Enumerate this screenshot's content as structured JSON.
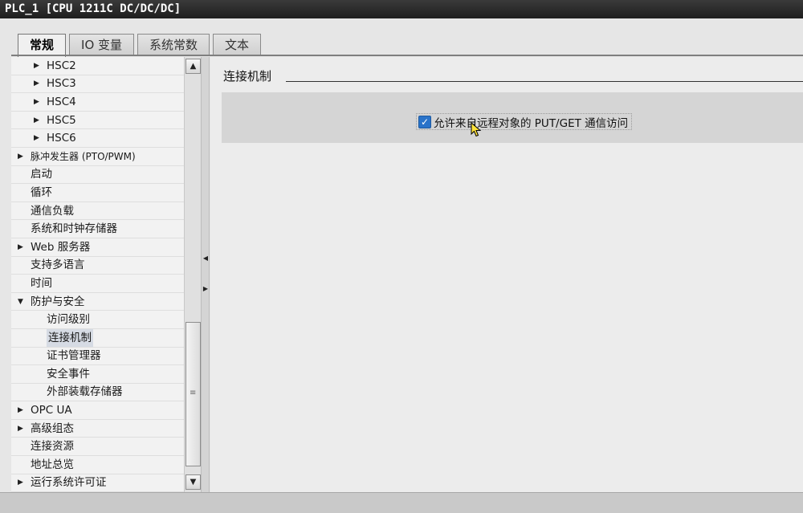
{
  "window": {
    "title": "PLC_1 [CPU 1211C DC/DC/DC]"
  },
  "tabs": [
    {
      "label": "常规",
      "active": true
    },
    {
      "label": "IO 变量",
      "active": false
    },
    {
      "label": "系统常数",
      "active": false
    },
    {
      "label": "文本",
      "active": false
    }
  ],
  "tree": {
    "items": [
      {
        "label": "HSC2",
        "arrow": "right",
        "level": 1
      },
      {
        "label": "HSC3",
        "arrow": "right",
        "level": 1
      },
      {
        "label": "HSC4",
        "arrow": "right",
        "level": 1
      },
      {
        "label": "HSC5",
        "arrow": "right",
        "level": 1
      },
      {
        "label": "HSC6",
        "arrow": "right",
        "level": 1
      },
      {
        "label": "脉冲发生器 (PTO/PWM)",
        "arrow": "right",
        "level": 0
      },
      {
        "label": "启动",
        "arrow": "none",
        "level": 0
      },
      {
        "label": "循环",
        "arrow": "none",
        "level": 0
      },
      {
        "label": "通信负载",
        "arrow": "none",
        "level": 0
      },
      {
        "label": "系统和时钟存储器",
        "arrow": "none",
        "level": 0
      },
      {
        "label": "Web 服务器",
        "arrow": "right",
        "level": 0
      },
      {
        "label": "支持多语言",
        "arrow": "none",
        "level": 0
      },
      {
        "label": "时间",
        "arrow": "none",
        "level": 0
      },
      {
        "label": "防护与安全",
        "arrow": "down",
        "level": 0
      },
      {
        "label": "访问级别",
        "arrow": "none",
        "level": 1
      },
      {
        "label": "连接机制",
        "arrow": "none",
        "level": 1,
        "selected": true
      },
      {
        "label": "证书管理器",
        "arrow": "none",
        "level": 1
      },
      {
        "label": "安全事件",
        "arrow": "none",
        "level": 1
      },
      {
        "label": "外部装载存储器",
        "arrow": "none",
        "level": 1
      },
      {
        "label": "OPC UA",
        "arrow": "right",
        "level": 0
      },
      {
        "label": "高级组态",
        "arrow": "right",
        "level": 0
      },
      {
        "label": "连接资源",
        "arrow": "none",
        "level": 0
      },
      {
        "label": "地址总览",
        "arrow": "none",
        "level": 0
      },
      {
        "label": "运行系统许可证",
        "arrow": "right",
        "level": 0
      }
    ]
  },
  "content": {
    "section_title": "连接机制",
    "checkbox": {
      "label": "允许来自远程对象的 PUT/GET 通信访问",
      "checked": true
    }
  },
  "icons": {
    "arrow_right": "▶",
    "arrow_down": "▼",
    "scroll_up": "▲",
    "scroll_down": "▼",
    "check": "✓",
    "grip": "≡"
  },
  "colors": {
    "checkbox_accent": "#2a73c9",
    "titlebar": "#1e1e1e"
  }
}
